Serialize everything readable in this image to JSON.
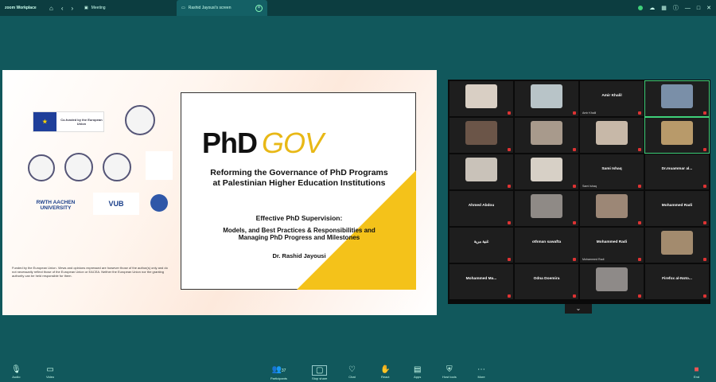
{
  "topbar": {
    "brand": "zoom Workplace",
    "tab1": "Meeting",
    "tab2": "Rashid Jayousi's screen"
  },
  "slide": {
    "title_part1": "PhD",
    "title_part2": "GOV",
    "subtitle": "Reforming the Governance of PhD Programs at Palestinian Higher Education Institutions",
    "session_title": "Effective PhD Supervision:",
    "session_subtitle": "Models, and Best Practices & Responsibilities and Managing PhD Progress and Milestones",
    "presenter": "Dr. Rashid Jayousi",
    "eu_logo_text": "Co-funded by the European Union",
    "rwth_text": "RWTH AACHEN UNIVERSITY",
    "vub_text": "VUB",
    "funding_note": "Funded by the European Union. Views and opinions expressed are however those of the author(s) only and do not necessarily reflect those of the European Union or EACEA. Neither the European Union nor the granting authority can be held responsible for them."
  },
  "participants": [
    {
      "name": "",
      "label": ""
    },
    {
      "name": "",
      "label": ""
    },
    {
      "name": "Amir Khalil",
      "label": "Amir Khalil"
    },
    {
      "name": "",
      "label": ""
    },
    {
      "name": "",
      "label": ""
    },
    {
      "name": "",
      "label": ""
    },
    {
      "name": "",
      "label": ""
    },
    {
      "name": "",
      "label": ""
    },
    {
      "name": "",
      "label": ""
    },
    {
      "name": "",
      "label": ""
    },
    {
      "name": "Sami Ishaq",
      "label": "Sami Ishaq"
    },
    {
      "name": "Dr.muammar al...",
      "label": ""
    },
    {
      "name": "Ahmed Abdou",
      "label": ""
    },
    {
      "name": "",
      "label": ""
    },
    {
      "name": "",
      "label": ""
    },
    {
      "name": "Mohammed Radi",
      "label": ""
    },
    {
      "name": "",
      "label": ""
    },
    {
      "name": "",
      "label": ""
    },
    {
      "name": "Mohammed Radi",
      "label": "Mohammed Radi"
    },
    {
      "name": "",
      "label": ""
    },
    {
      "name": "Mohammed Ma...",
      "label": ""
    },
    {
      "name": "Odna Doemira",
      "label": ""
    },
    {
      "name": "",
      "label": ""
    },
    {
      "name": "",
      "label": ""
    }
  ],
  "toolbar": {
    "audio": "Audio",
    "video": "Video",
    "participants": "Participants",
    "participants_count": "37",
    "share": "Stop share",
    "chat": "Chat",
    "react": "React",
    "apps": "Apps",
    "host_tools": "Host tools",
    "more": "More",
    "end": "End"
  }
}
